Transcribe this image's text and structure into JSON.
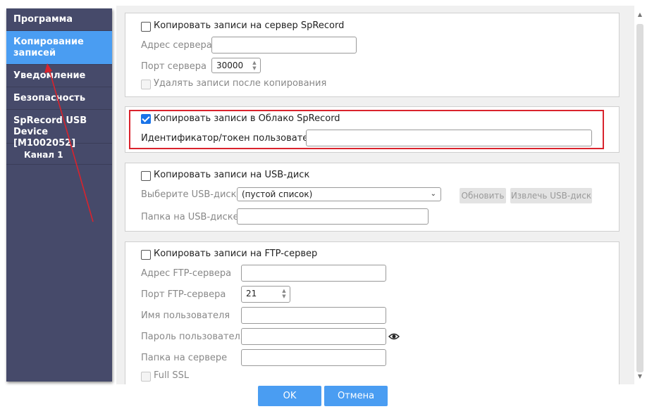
{
  "sidebar": {
    "items": [
      {
        "label": "Программа"
      },
      {
        "label": "Копирование записей"
      },
      {
        "label": "Уведомление"
      },
      {
        "label": "Безопасность"
      },
      {
        "label": "SpRecord USB Device [M1002052]"
      },
      {
        "label": "Канал 1"
      }
    ],
    "active_index": 1
  },
  "server_group": {
    "checkbox_label": "Копировать записи на сервер SpRecord",
    "checked": false,
    "address_label": "Адрес сервера",
    "address_value": "",
    "port_label": "Порт сервера",
    "port_value": "30000",
    "delete_label": "Удалять записи после копирования"
  },
  "cloud_group": {
    "checkbox_label": "Копировать записи в Облако SpRecord",
    "checked": true,
    "token_label": "Идентификатор/токен пользователя",
    "token_value": ""
  },
  "usb_group": {
    "checkbox_label": "Копировать записи на USB-диск",
    "checked": false,
    "select_label": "Выберите USB-диск:",
    "select_value": "(пустой список)",
    "refresh_label": "Обновить",
    "eject_label": "Извлечь USB-диск",
    "folder_label": "Папка на USB-диске:",
    "folder_value": ""
  },
  "ftp_group": {
    "checkbox_label": "Копировать записи на FTP-сервер",
    "checked": false,
    "address_label": "Адрес FTP-сервера",
    "port_label": "Порт FTP-сервера",
    "port_value": "21",
    "user_label": "Имя пользователя",
    "password_label": "Пароль пользователя",
    "folder_label": "Папка на сервере",
    "ssl_label": "Full SSL"
  },
  "footer": {
    "ok_label": "OK",
    "cancel_label": "Отмена"
  },
  "colors": {
    "sidebar_bg": "#464a6a",
    "accent": "#4a9df2",
    "highlight_border": "#d9232d",
    "annotation_arrow": "#d9232d"
  }
}
